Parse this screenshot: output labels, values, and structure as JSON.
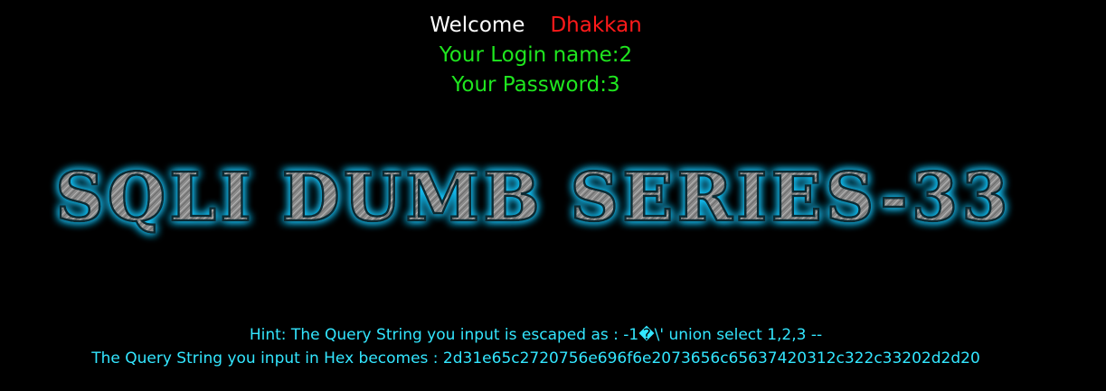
{
  "welcome": {
    "greeting": "Welcome",
    "user": "Dhakkan",
    "login_line": "Your Login name:2",
    "password_line": "Your Password:3"
  },
  "banner": {
    "title": "SQLI DUMB SERIES-33"
  },
  "hint": {
    "escaped_line": "Hint: The Query String you input is escaped as : -1�\\' union select 1,2,3 --",
    "hex_line": "The Query String you input in Hex becomes : 2d31e65c2720756e696f6e2073656c65637420312c322c33202d2d20"
  },
  "colors": {
    "background": "#000000",
    "greeting": "#ffffff",
    "user": "#ff1a1a",
    "info": "#1fe61f",
    "hint": "#33e6ff",
    "banner_glow": "#19c8ff"
  }
}
